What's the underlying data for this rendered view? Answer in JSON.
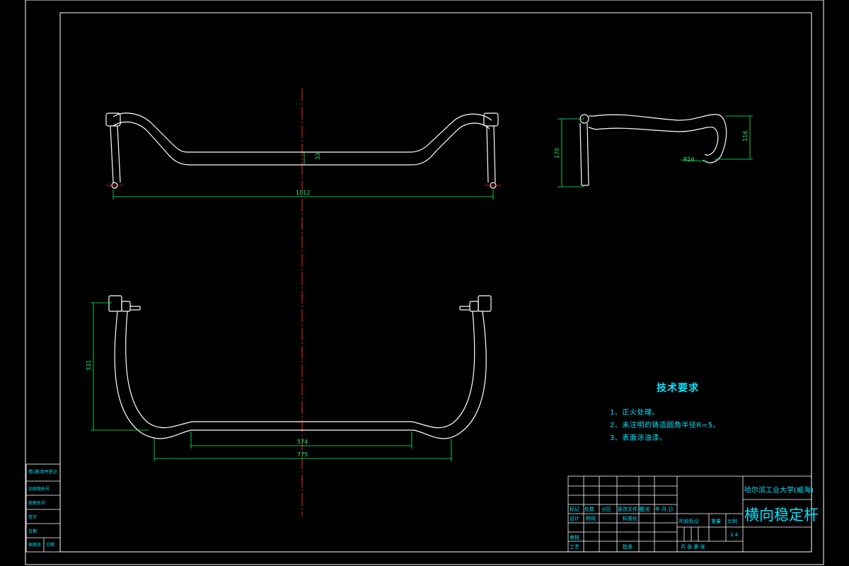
{
  "dimensions": {
    "front_thickness": "33",
    "front_width": "1012",
    "side_height": "170",
    "side_radius": "R16",
    "side_right_height": "116",
    "top_height": "331",
    "top_inner_width": "574",
    "top_outer_width": "775"
  },
  "requirements": {
    "title": "技术要求",
    "items": [
      "1、正火处理。",
      "2、未注明的铸造圆角半径R=5。",
      "3、表面涂油漆。"
    ]
  },
  "title_block": {
    "school": "哈尔滨工业大学(威海)",
    "part_name": "横向稳定杆",
    "labels": {
      "biaoji": "标记",
      "chushu": "处数",
      "fenqu": "分区",
      "gengaiwenjianhao": "更改文件号",
      "qianming": "签名",
      "nianyueri": "年.月.日",
      "sheji": "设计",
      "designer": "杨铭",
      "biaozhunhua": "标准化",
      "jieduanbiaoji": "阶段标记",
      "zhongliang": "重量",
      "bili": "比例",
      "scale": "1:4",
      "shenhe": "审核",
      "gongyi": "工艺",
      "pizhun": "批准",
      "gongzhang": "共  张  第  张"
    }
  },
  "side_table": {
    "rows": [
      "借(通)用件登记",
      "旧底图总号",
      "底图总号",
      "签字",
      "日期"
    ],
    "last": [
      "档案员",
      "日期"
    ]
  },
  "colors": {
    "background": "#000000",
    "frame": "#ffffff",
    "dimension": "#00ff66",
    "center_line": "#ff2020",
    "text": "#00e5ff"
  }
}
